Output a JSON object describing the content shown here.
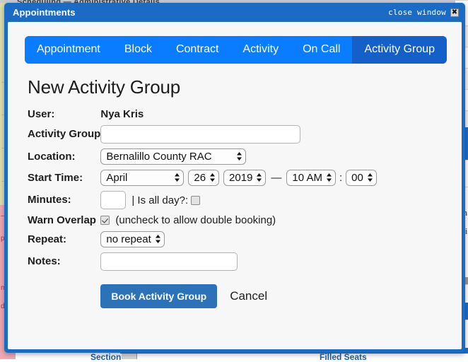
{
  "window": {
    "title": "Appointments",
    "close_label": "close window",
    "close_icon": "close-x-icon"
  },
  "tabs": [
    {
      "label": "Appointment",
      "active": false
    },
    {
      "label": "Block",
      "active": false
    },
    {
      "label": "Contract",
      "active": false
    },
    {
      "label": "Activity",
      "active": false
    },
    {
      "label": "On Call",
      "active": false
    },
    {
      "label": "Activity Group",
      "active": true
    }
  ],
  "page_title": "New Activity Group",
  "form": {
    "user_label": "User:",
    "user_value": "Nya Kris",
    "activity_group_label": "Activity Group",
    "activity_group_value": "",
    "activity_group_placeholder": "",
    "location_label": "Location:",
    "location_value": "Bernalillo County RAC",
    "start_time_label": "Start Time:",
    "month_value": "April",
    "day_value": "26",
    "year_value": "2019",
    "range_dash": "—",
    "hour_value": "10 AM",
    "time_colon": ":",
    "minute_value": "00",
    "minutes_label": "Minutes:",
    "minutes_value": "",
    "all_day_prefix": "| Is all day?:",
    "all_day_checked": false,
    "warn_overlap_label": "Warn Overlap",
    "warn_overlap_checked": true,
    "warn_overlap_hint": "(uncheck to allow double booking)",
    "repeat_label": "Repeat:",
    "repeat_value": "no repeat",
    "notes_label": "Notes:",
    "notes_value": "",
    "notes_placeholder": ""
  },
  "actions": {
    "book_label": "Book Activity Group",
    "cancel_label": "Cancel"
  },
  "background": {
    "top_text": "Scheduling  —  Administrative Details",
    "right_link_1": "m",
    "right_link_2": "i",
    "bottom_text_left": "Section",
    "bottom_text_right": "Filled Seats"
  },
  "colors": {
    "window_chrome": "#1b6ac4",
    "tab_blue": "#0a7cff",
    "tab_active_blue": "#1560c8",
    "primary_button": "#2d72b8",
    "body_bg": "#f7f7f7"
  }
}
